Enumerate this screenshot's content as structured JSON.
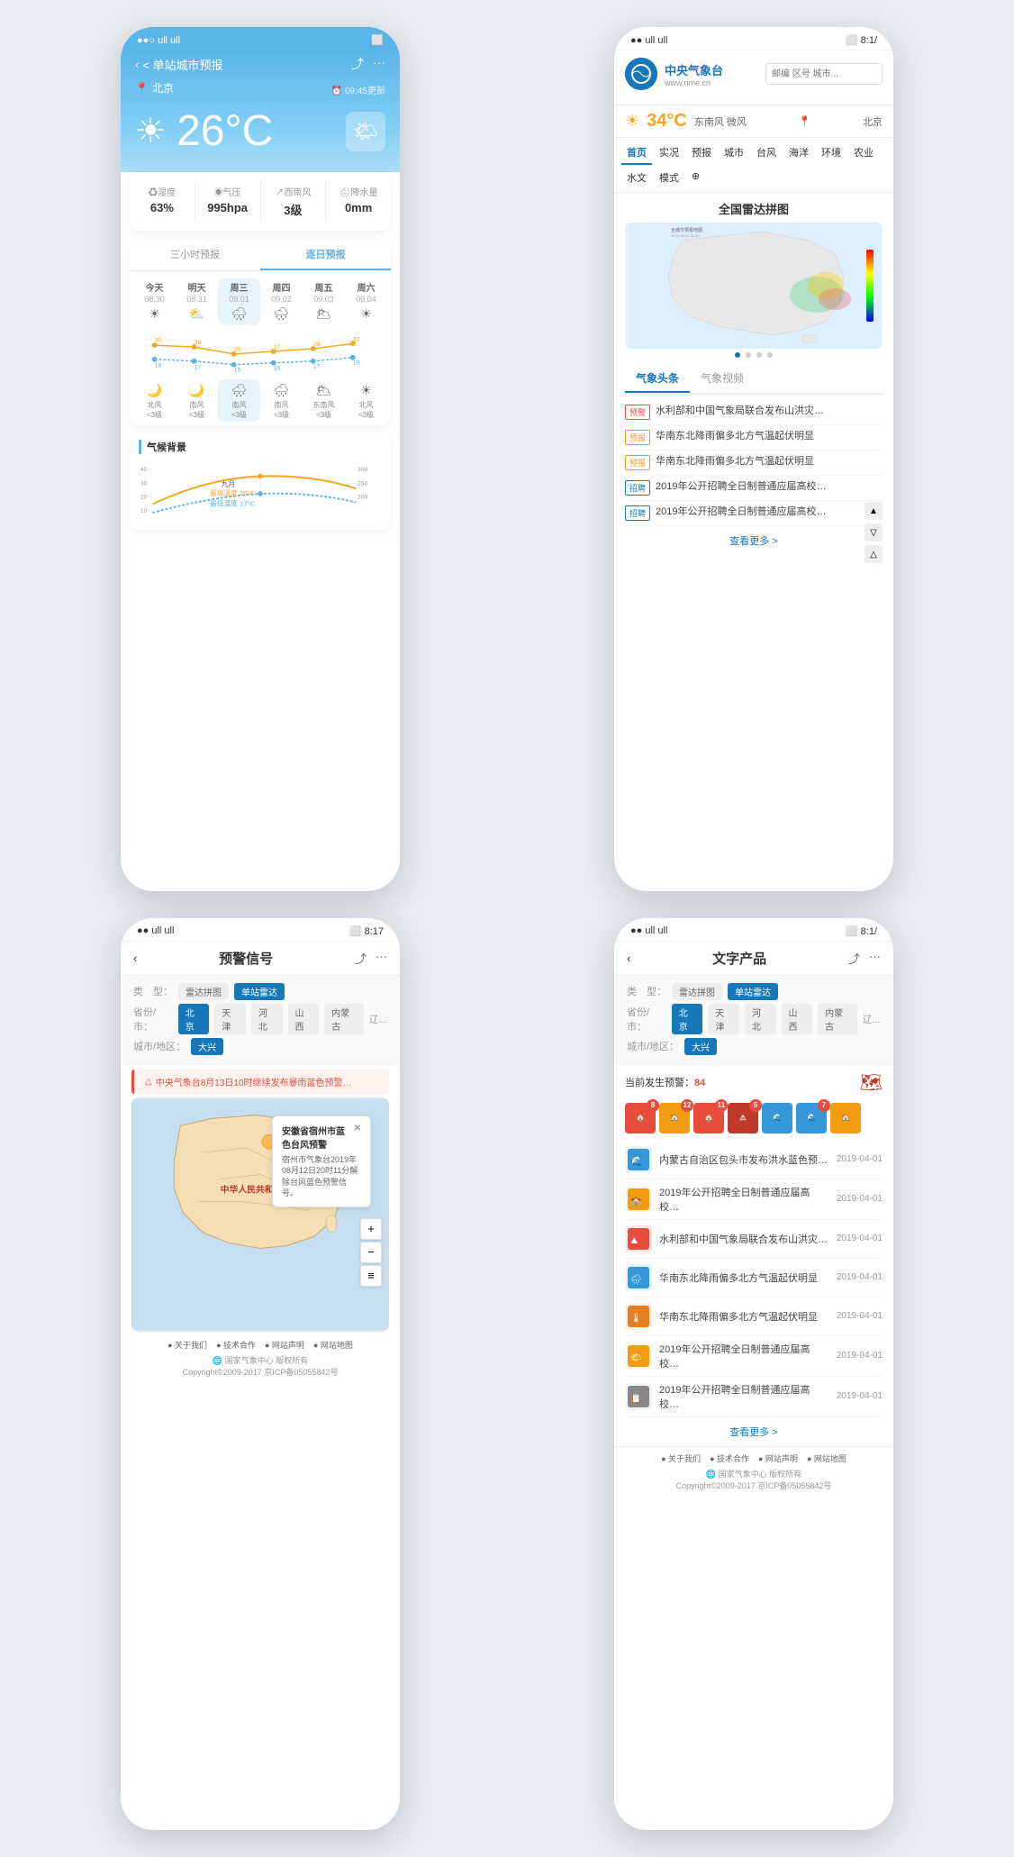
{
  "phone1": {
    "status": {
      "left": "●●○ ull ull",
      "right_battery": "⬜",
      "right_time": ""
    },
    "header": {
      "back_label": "< 单站城市预报",
      "share_icon": "share",
      "more_icon": "...",
      "location": "北京",
      "location_icon": "📍",
      "update_time": "⏰ 09:45更新"
    },
    "temperature": "26°C",
    "weather_icon": "🌤",
    "stats": [
      {
        "label": "♻湿度",
        "value": "63%"
      },
      {
        "label": "◉气压",
        "value": "995hpa"
      },
      {
        "label": "↗西南风",
        "value": "3级"
      },
      {
        "label": "🌧降水量",
        "value": "0mm"
      }
    ],
    "forecast": {
      "tabs": [
        {
          "label": "三小时预报",
          "active": false
        },
        {
          "label": "逐日预报",
          "active": true
        }
      ],
      "days": [
        {
          "name": "今天",
          "date": "08.30",
          "icon": "☀",
          "highlight": false
        },
        {
          "name": "明天",
          "date": "08.31",
          "icon": "⛅",
          "highlight": false
        },
        {
          "name": "周三",
          "date": "09.01",
          "icon": "🌧",
          "highlight": true
        },
        {
          "name": "周四",
          "date": "09.02",
          "icon": "🌧",
          "highlight": false
        },
        {
          "name": "周五",
          "date": "09.03",
          "icon": "🌥",
          "highlight": false
        },
        {
          "name": "周六",
          "date": "09.04",
          "icon": "☀",
          "highlight": false
        }
      ],
      "days2": [
        {
          "icon": "🌙",
          "wind": "北风\n<3级",
          "highlight": false
        },
        {
          "icon": "🌙",
          "wind": "南风\n<3级",
          "highlight": false
        },
        {
          "icon": "🌧",
          "wind": "南风\n<3级",
          "highlight": true
        },
        {
          "icon": "🌧",
          "wind": "南风\n<3级",
          "highlight": false
        },
        {
          "icon": "🌥",
          "wind": "东南风\n<3级",
          "highlight": false
        },
        {
          "icon": "☀",
          "wind": "北风\n<3级",
          "highlight": false
        }
      ]
    },
    "climate": {
      "title": "气候背景",
      "month_label": "九月",
      "max_temp": "28°C",
      "min_temp": "17°C",
      "max_label": "最高温度",
      "min_label": "最低温度"
    }
  },
  "phone2": {
    "status": {
      "left": "●● ull ull",
      "right": "⬜ 8:1/"
    },
    "logo_name": "中央气象台",
    "logo_url": "www.nme.cn",
    "search_placeholder": "邮编 区号 城市...",
    "temperature": "34°C",
    "weather": "东南风 微风",
    "city": "北京",
    "nav_items": [
      {
        "label": "首页",
        "active": true
      },
      {
        "label": "实况",
        "active": false
      },
      {
        "label": "预报",
        "active": false
      },
      {
        "label": "城市",
        "active": false
      },
      {
        "label": "台风",
        "active": false
      },
      {
        "label": "海洋",
        "active": false
      },
      {
        "label": "环境",
        "active": false
      },
      {
        "label": "农业",
        "active": false
      },
      {
        "label": "水文",
        "active": false
      },
      {
        "label": "模式",
        "active": false
      },
      {
        "label": "⊕",
        "active": false
      }
    ],
    "radar_title": "全国雷达拼图",
    "news_tabs": [
      {
        "label": "气象头条",
        "active": true
      },
      {
        "label": "气象视频",
        "active": false
      }
    ],
    "news_items": [
      {
        "tag": "预警",
        "tag_type": "red",
        "text": "水利部和中国气象局联合发布山洪灾…"
      },
      {
        "tag": "预报",
        "tag_type": "orange",
        "text": "华南东北降雨偏多北方气温起伏明显"
      },
      {
        "tag": "预报",
        "tag_type": "orange",
        "text": "华南东北降雨偏多北方气温起伏明显"
      },
      {
        "tag": "招聘",
        "tag_type": "blue",
        "text": "2019年公开招聘全日制普通应届高校…"
      },
      {
        "tag": "招聘",
        "tag_type": "blue",
        "text": "2019年公开招聘全日制普通应届高校…"
      }
    ],
    "more_label": "查看更多 >",
    "scroll_icons": [
      "▲",
      "▽",
      "△"
    ]
  },
  "phone3": {
    "status": {
      "left": "●● ull ull",
      "right": "⬜ 8:17"
    },
    "back_label": "<",
    "title": "预警信号",
    "share_icon": "share",
    "more_icon": "...",
    "filter": {
      "type_label": "类　型：",
      "type_options": [
        "雷达拼图",
        "单站雷达"
      ],
      "province_label": "省份/市：",
      "province_options": [
        "北京",
        "天津",
        "河北",
        "山西",
        "内蒙古",
        "辽…"
      ],
      "city_label": "城市/地区：",
      "city_options": [
        "大兴"
      ]
    },
    "alert_text": "△ 中央气象台8月13日10时继续发布暴雨蓝色预警…",
    "popup": {
      "title": "安徽省宿州市蓝色台风预警",
      "text": "宿州市气象台2019年08月12日20时11分解除台风蓝色预警信号。"
    },
    "map_china_label": "中华人民共和国",
    "map_controls": [
      "+",
      "−",
      "≡"
    ],
    "footer_links": [
      "关于我们",
      "技术合作",
      "网站声明",
      "网站地图"
    ],
    "footer_brand": "🌐 国家气象中心 版权所有",
    "copyright": "Copyright©2009-2017 京ICP备05055842号"
  },
  "phone4": {
    "status": {
      "left": "●● ull ull",
      "right": "⬜ 8:1/"
    },
    "back_label": "<",
    "title": "文字产品",
    "share_icon": "share",
    "more_icon": "...",
    "filter": {
      "type_label": "类　型：",
      "type_options": [
        "雷达拼图",
        "单站雷达"
      ],
      "province_label": "省份/市：",
      "province_options": [
        "北京",
        "天津",
        "河北",
        "山西",
        "内蒙古",
        "辽…"
      ],
      "city_label": "城市/地区：",
      "city_options": [
        "大兴"
      ]
    },
    "warning_label": "当前发生预警：",
    "warning_count": "84",
    "warning_icons": [
      {
        "icon": "🏠",
        "color": "#e74c3c",
        "count": "8"
      },
      {
        "icon": "🏠",
        "color": "#f39c12",
        "count": "12"
      },
      {
        "icon": "🏠",
        "color": "#e74c3c",
        "count": "11"
      },
      {
        "icon": "🏠",
        "color": "#c0392b",
        "count": "5"
      },
      {
        "icon": "🌊",
        "color": "#3498db",
        "count": ""
      },
      {
        "icon": "🌊",
        "color": "#3498db",
        "count": "7"
      },
      {
        "icon": "🏠",
        "color": "#f39c12",
        "count": ""
      }
    ],
    "list_items": [
      {
        "color": "#3498db",
        "icon": "🌊",
        "text": "内蒙古自治区包头市发布洪水蓝色预…",
        "date": "2019-04-01"
      },
      {
        "color": "#f39c12",
        "icon": "🏫",
        "text": "2019年公开招聘全日制普通应届高校…",
        "date": "2019-04-01"
      },
      {
        "color": "#e74c3c",
        "icon": "⛰",
        "text": "水利部和中国气象局联合发布山洪灾…",
        "date": "2019-04-01"
      },
      {
        "color": "#3498db",
        "icon": "🌧",
        "text": "华南东北降雨偏多北方气温起伏明显",
        "date": "2019-04-01"
      },
      {
        "color": "#e67e22",
        "icon": "🌡",
        "text": "华南东北降雨偏多北方气温起伏明显",
        "date": "2019-04-01"
      },
      {
        "color": "#f39c12",
        "icon": "🌤",
        "text": "2019年公开招聘全日制普通应届高校…",
        "date": "2019-04-01"
      },
      {
        "color": "#666",
        "icon": "📋",
        "text": "2019年公开招聘全日制普通应届高校…",
        "date": "2019-04-01"
      }
    ],
    "more_label": "查看更多 >",
    "footer_links": [
      "关于我们",
      "技术合作",
      "网站声明",
      "网站地图"
    ],
    "footer_brand": "🌐 国家气象中心 版权所有",
    "copyright": "Copyright©2009-2017 京ICP备05055842号"
  }
}
